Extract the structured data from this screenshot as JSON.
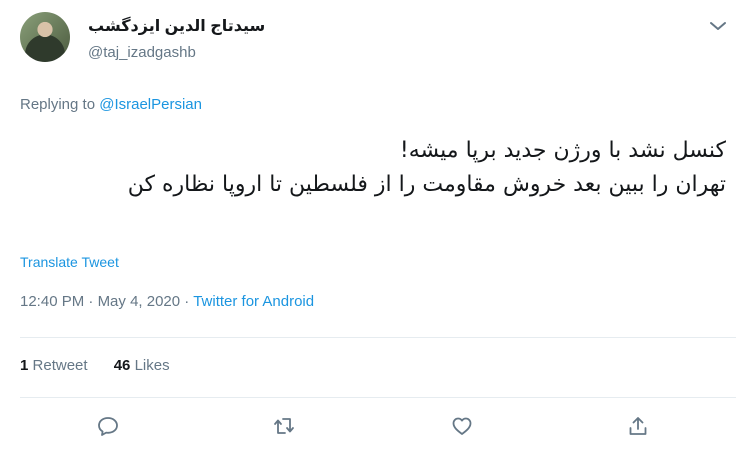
{
  "author": {
    "display_name": "سیدتاج الدین ایزدگشب",
    "handle": "@taj_izadgashb"
  },
  "reply": {
    "prefix": "Replying to",
    "target": "@IsraelPersian"
  },
  "tweet": {
    "line1": "کنسل نشد با ورژن جدید برپا میشه!",
    "line2": "تهران را ببین بعد خروش مقاومت را از فلسطین تا اروپا نظاره کن"
  },
  "translate_label": "Translate Tweet",
  "meta": {
    "time": "12:40 PM",
    "dot1": "·",
    "date": "May 4, 2020",
    "dot2": "·",
    "source": "Twitter for Android"
  },
  "stats": {
    "retweets": "1",
    "retweets_label": "Retweet",
    "likes": "46",
    "likes_label": "Likes"
  },
  "colors": {
    "link": "#1b95e0",
    "muted": "#657786",
    "text": "#14171a",
    "divider": "#e6ecf0"
  },
  "icons": [
    "chevron-down-icon",
    "reply-icon",
    "retweet-icon",
    "like-icon",
    "share-icon"
  ]
}
